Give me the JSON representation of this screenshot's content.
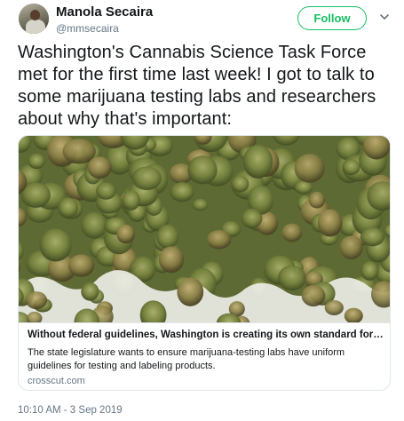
{
  "author": {
    "name": "Manola Secaira",
    "handle": "@mmsecaira"
  },
  "actions": {
    "follow_label": "Follow"
  },
  "tweet": {
    "text": "Washington's Cannabis Science Task Force met for the first time last week! I got to talk to some marijuana testing labs and researchers about why that's important:",
    "timestamp": "10:10 AM - 3 Sep 2019"
  },
  "card": {
    "title": "Without federal guidelines, Washington is creating its own standard for testin...",
    "description": "The state legislature wants to ensure marijuana-testing labs have uniform guidelines for testing and labeling products.",
    "domain": "crosscut.com"
  },
  "colors": {
    "follow_green": "#17bf63",
    "secondary_text": "#657786",
    "primary_text": "#14171a"
  },
  "icons": {
    "menu": "chevron-down-icon"
  }
}
